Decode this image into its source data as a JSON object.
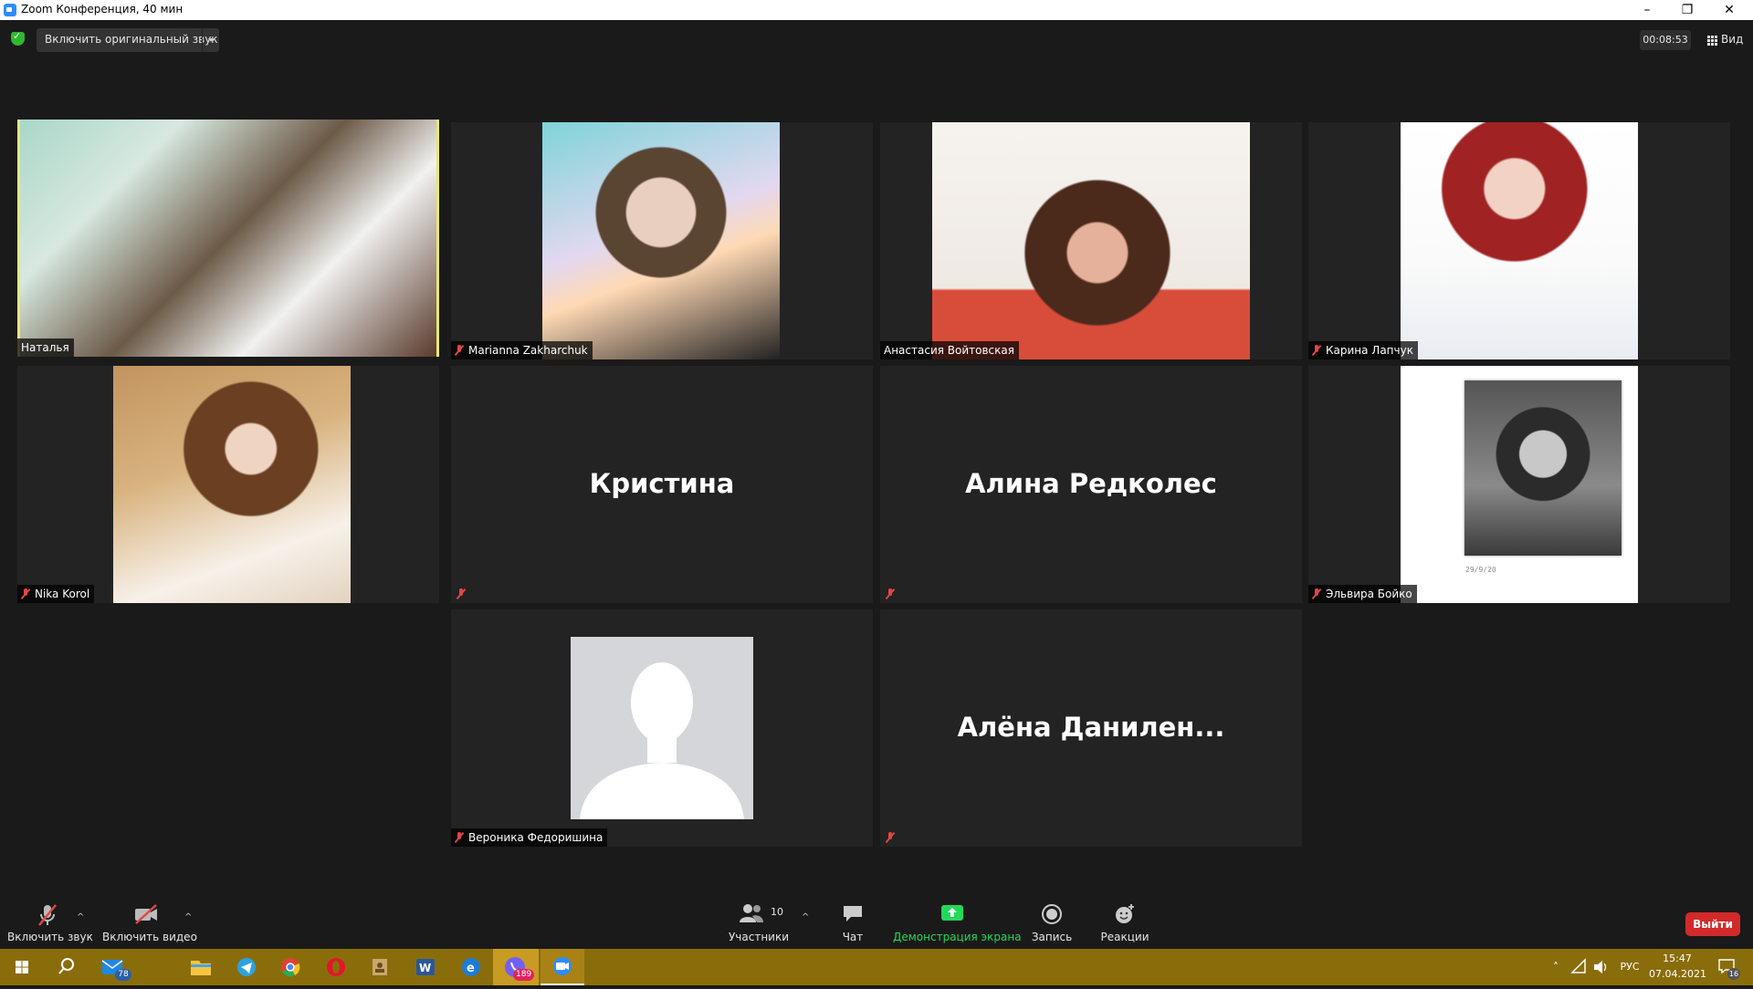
{
  "window": {
    "title": "Zoom Конференция, 40 мин",
    "minimize": "–",
    "restore": "❐",
    "close": "✕"
  },
  "top_bar": {
    "original_sound_label": "Включить оригинальный звук",
    "timer": "00:08:53",
    "view_label": "Вид"
  },
  "participants": [
    {
      "name": "Наталья",
      "muted": false,
      "active_speaker": true
    },
    {
      "name": "Marianna Zakharchuk",
      "muted": true
    },
    {
      "name": "Анастасия Войтовская",
      "muted": false
    },
    {
      "name": "Карина Лапчук",
      "muted": true
    },
    {
      "name": "Nika Korol",
      "muted": true
    },
    {
      "name": "Кристина",
      "muted": true
    },
    {
      "name": "Алина Редколес",
      "muted": true
    },
    {
      "name": "Эльвира Бойко",
      "muted": true,
      "photo_date": "29/9/20"
    },
    {
      "name": "Вероника Федоришина",
      "muted": true
    },
    {
      "name": "Алёна  Данилен...",
      "muted": true
    }
  ],
  "toolbar": {
    "unmute_label": "Включить звук",
    "start_video_label": "Включить видео",
    "participants_label": "Участники",
    "participants_count": "10",
    "chat_label": "Чат",
    "share_label": "Демонстрация экрана",
    "record_label": "Запись",
    "reactions_label": "Реакции",
    "leave_label": "Выйти"
  },
  "taskbar": {
    "mail_badge": "78",
    "viber_badge": "189",
    "language": "РУС",
    "time": "15:47",
    "date": "07.04.2021",
    "notifications_badge": "16"
  },
  "colors": {
    "accent_share": "#23d959",
    "leave_red": "#d22a2a",
    "active_speaker_border": "#e8e879",
    "taskbar": "#8a6d0b"
  }
}
